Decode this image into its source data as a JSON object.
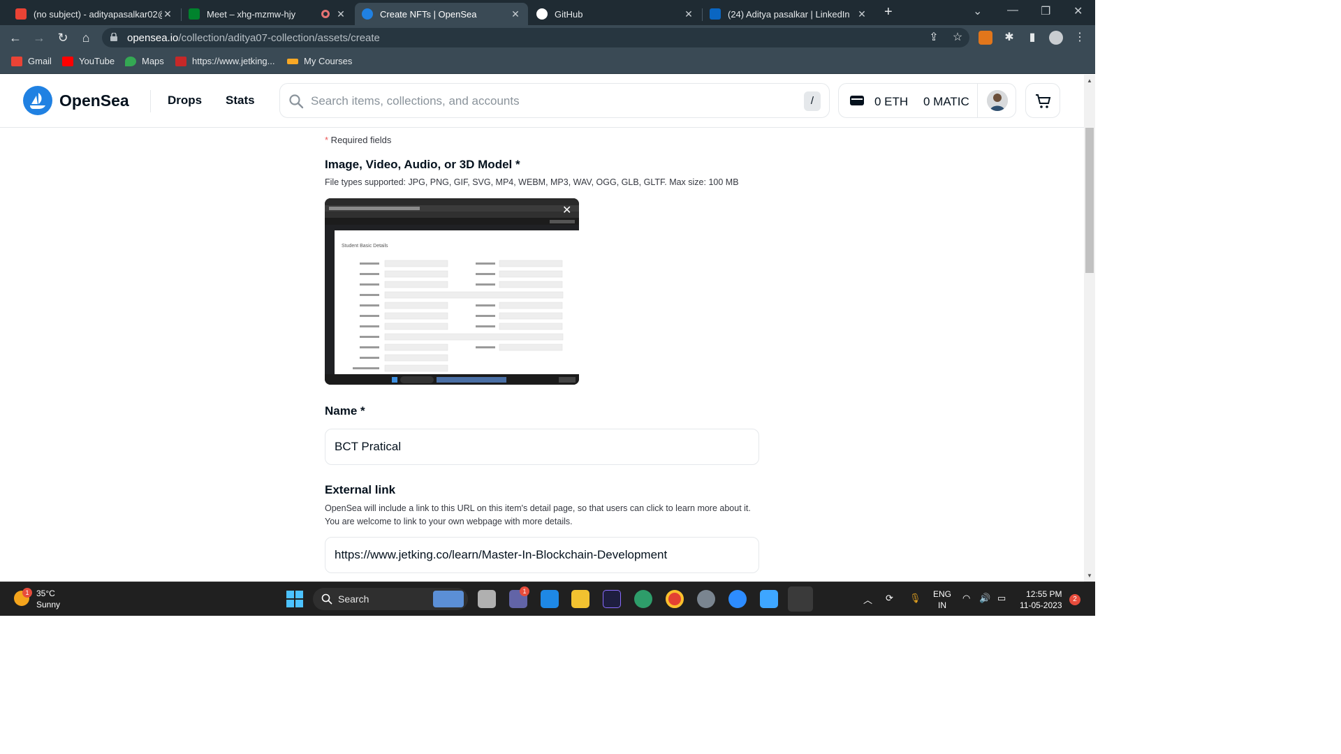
{
  "browser": {
    "tabs": [
      {
        "label": "(no subject) - adityapasalkar02@",
        "icon": "gmail-icon",
        "active": false
      },
      {
        "label": "Meet – xhg-mzmw-hjy",
        "icon": "meet-icon",
        "active": false
      },
      {
        "label": "Create NFTs | OpenSea",
        "icon": "opensea-icon",
        "active": true
      },
      {
        "label": "GitHub",
        "icon": "github-icon",
        "active": false
      },
      {
        "label": "(24) Aditya pasalkar | LinkedIn",
        "icon": "linkedin-icon",
        "active": false
      }
    ],
    "url_host": "opensea.io",
    "url_path": "/collection/aditya07-collection/assets/create",
    "bookmarks": [
      {
        "label": "Gmail",
        "icon": "gmail-icon"
      },
      {
        "label": "YouTube",
        "icon": "youtube-icon"
      },
      {
        "label": "Maps",
        "icon": "maps-icon"
      },
      {
        "label": "https://www.jetking...",
        "icon": "jetking-icon"
      },
      {
        "label": "My Courses",
        "icon": "courses-icon"
      }
    ]
  },
  "header": {
    "brand": "OpenSea",
    "nav": [
      "Drops",
      "Stats"
    ],
    "search_placeholder": "Search items, collections, and accounts",
    "search_shortcut": "/",
    "eth_balance": "0 ETH",
    "matic_balance": "0 MATIC"
  },
  "form": {
    "required_star": "*",
    "required_text": " Required fields",
    "media_label": "Image, Video, Audio, or 3D Model *",
    "media_desc": "File types supported: JPG, PNG, GIF, SVG, MP4, WEBM, MP3, WAV, OGG, GLB, GLTF. Max size: 100 MB",
    "preview_title": "Student Basic Details",
    "name_label": "Name *",
    "name_value": "BCT Pratical",
    "link_label": "External link",
    "link_desc": "OpenSea will include a link to this URL on this item's detail page, so that users can click to learn more about it. You are welcome to link to your own webpage with more details.",
    "link_value": "https://www.jetking.co/learn/Master-In-Blockchain-Development"
  },
  "taskbar": {
    "temperature": "35°C",
    "condition": "Sunny",
    "weather_badge": "1",
    "search_label": "Search",
    "teams_badge": "1",
    "language": "ENG",
    "region": "IN",
    "time": "12:55 PM",
    "date": "11-05-2023",
    "notifications": "2"
  }
}
